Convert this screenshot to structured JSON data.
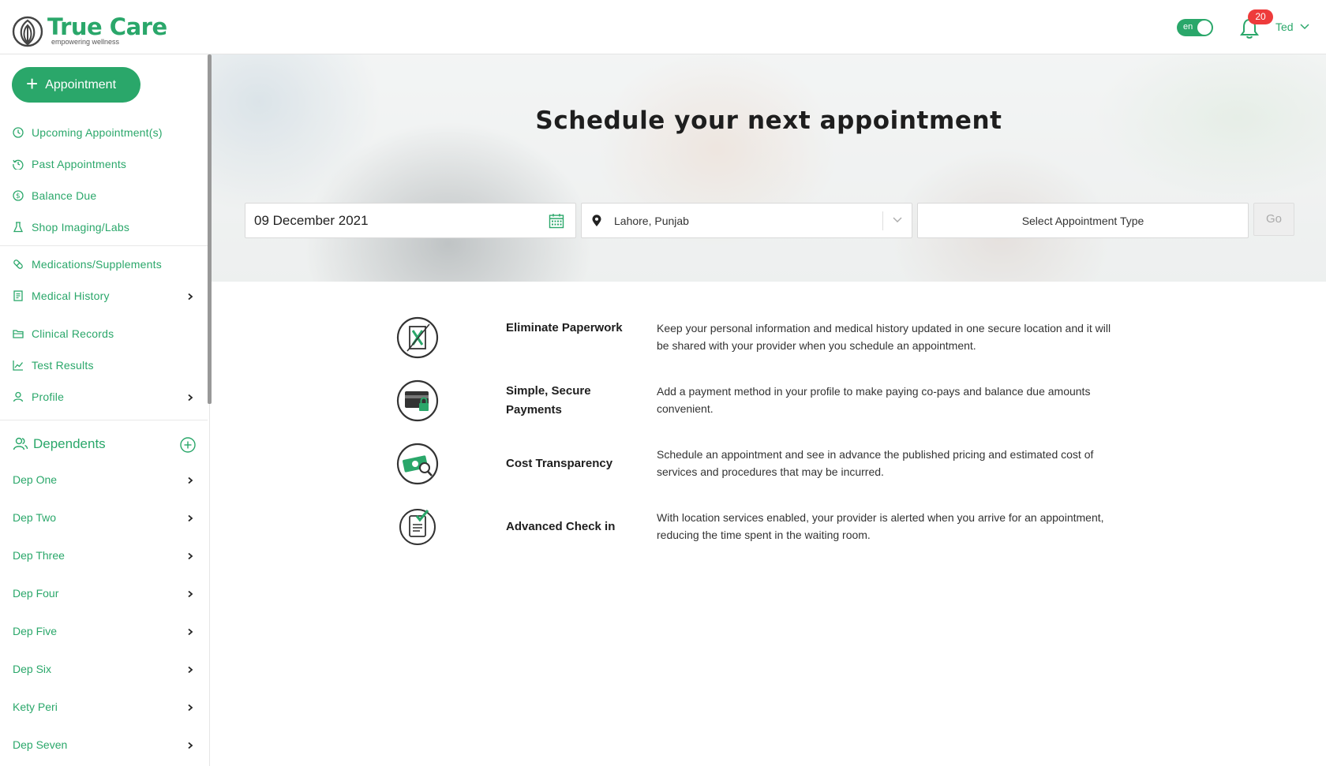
{
  "brand": {
    "name": "True Care",
    "tagline": "empowering wellness",
    "accent": "#2aa76a"
  },
  "header": {
    "lang": "en",
    "notifications": "20",
    "user": "Ted"
  },
  "sidebar": {
    "appointment_button": "Appointment",
    "items": [
      {
        "label": "Upcoming Appointment(s)",
        "icon": "clock-icon"
      },
      {
        "label": "Past Appointments",
        "icon": "history-icon"
      },
      {
        "label": "Balance Due",
        "icon": "dollar-icon"
      },
      {
        "label": "Shop Imaging/Labs",
        "icon": "flask-icon"
      },
      {
        "label": "Medications/Supplements",
        "icon": "pill-icon"
      },
      {
        "label": "Medical History",
        "icon": "document-icon"
      },
      {
        "label": "Clinical Records",
        "icon": "folder-icon"
      },
      {
        "label": "Test Results",
        "icon": "chart-icon"
      },
      {
        "label": "Profile",
        "icon": "user-icon"
      }
    ],
    "dependents_title": "Dependents",
    "dependents": [
      "Dep One",
      "Dep Two",
      "Dep Three",
      "Dep Four",
      "Dep Five",
      "Dep Six",
      "Kety Peri",
      "Dep Seven"
    ]
  },
  "hero": {
    "title": "Schedule your next appointment",
    "date": "09 December 2021",
    "location": "Lahore, Punjab",
    "appointment_type": "Select Appointment Type",
    "go": "Go"
  },
  "features": [
    {
      "title": "Eliminate Paperwork",
      "desc": "Keep your personal information and medical history updated in one secure location and it will be shared with your provider when you schedule an appointment.",
      "icon": "no-paper-icon"
    },
    {
      "title": "Simple, Secure Payments",
      "desc": "Add a payment method in your profile to make paying co-pays and balance due amounts convenient.",
      "icon": "secure-card-icon"
    },
    {
      "title": "Cost Transparency",
      "desc": "Schedule an appointment and see in advance the published pricing and estimated cost of services and procedures that may be incurred.",
      "icon": "money-search-icon"
    },
    {
      "title": "Advanced Check in",
      "desc": "With location services enabled, your provider is alerted when you arrive for an appointment, reducing the time spent in the waiting room.",
      "icon": "checkin-icon"
    }
  ]
}
